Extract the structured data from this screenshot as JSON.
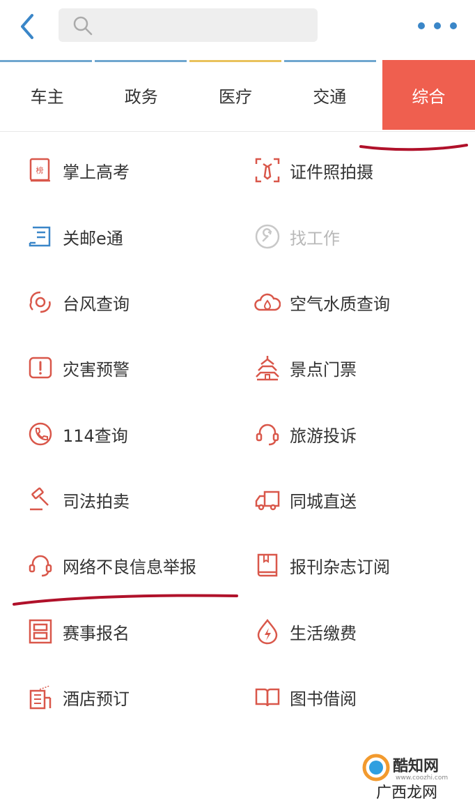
{
  "header": {
    "search_placeholder": ""
  },
  "tabs": [
    {
      "label": "车主",
      "accent": "#6fa6cf"
    },
    {
      "label": "政务",
      "accent": "#6fa6cf"
    },
    {
      "label": "医疗",
      "accent": "#e9c25c"
    },
    {
      "label": "交通",
      "accent": "#6fa6cf"
    },
    {
      "label": "综合",
      "accent": "#ef5f4f",
      "active": true
    }
  ],
  "services": {
    "left": [
      {
        "label": "掌上高考",
        "icon": "rank-board-icon"
      },
      {
        "label": "关邮e通",
        "icon": "customs-receipt-icon"
      },
      {
        "label": "台风查询",
        "icon": "typhoon-icon"
      },
      {
        "label": "灾害预警",
        "icon": "warning-icon"
      },
      {
        "label": "114查询",
        "icon": "phone-icon"
      },
      {
        "label": "司法拍卖",
        "icon": "gavel-icon"
      },
      {
        "label": "网络不良信息举报",
        "icon": "headset-icon"
      },
      {
        "label": "赛事报名",
        "icon": "event-signup-icon"
      },
      {
        "label": "酒店预订",
        "icon": "hotel-icon"
      }
    ],
    "right": [
      {
        "label": "证件照拍摄",
        "icon": "id-photo-icon"
      },
      {
        "label": "找工作",
        "icon": "wrench-icon",
        "disabled": true
      },
      {
        "label": "空气水质查询",
        "icon": "air-water-icon"
      },
      {
        "label": "景点门票",
        "icon": "pagoda-icon"
      },
      {
        "label": "旅游投诉",
        "icon": "headset-icon"
      },
      {
        "label": "同城直送",
        "icon": "truck-icon"
      },
      {
        "label": "报刊杂志订阅",
        "icon": "magazine-icon"
      },
      {
        "label": "生活缴费",
        "icon": "lightning-bill-icon"
      },
      {
        "label": "图书借阅",
        "icon": "open-book-icon"
      }
    ]
  },
  "colors": {
    "accent_red": "#ef5f4f",
    "icon_red": "#d9574a",
    "icon_blue": "#3a86c8",
    "disabled": "#c8c8c8",
    "handwriting": "#b0112a"
  },
  "watermark": {
    "brand": "酷知网",
    "url": "www.coozhi.com",
    "sub": "广西龙网"
  }
}
